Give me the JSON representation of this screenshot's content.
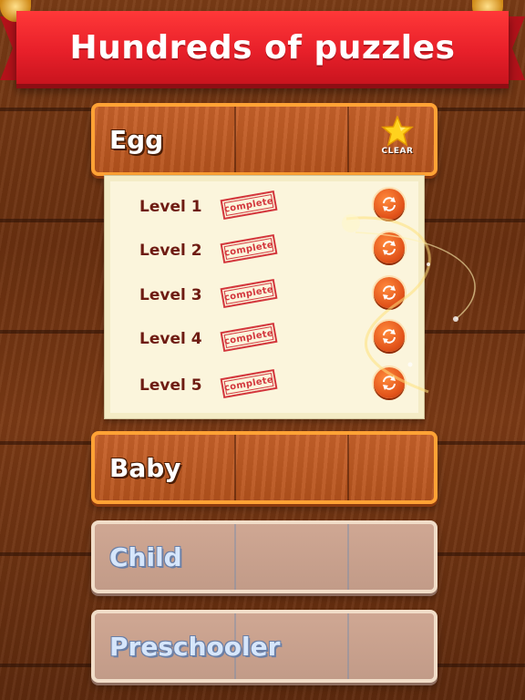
{
  "banner": {
    "title": "Hundreds of puzzles"
  },
  "categories": [
    {
      "label": "Egg",
      "state": "open",
      "badge": "CLEAR"
    },
    {
      "label": "Baby",
      "state": "unlocked"
    },
    {
      "label": "Child",
      "state": "locked"
    },
    {
      "label": "Preschooler",
      "state": "locked"
    }
  ],
  "levels": [
    {
      "label": "Level 1",
      "status": "complete"
    },
    {
      "label": "Level 2",
      "status": "complete"
    },
    {
      "label": "Level 3",
      "status": "complete"
    },
    {
      "label": "Level 4",
      "status": "complete"
    },
    {
      "label": "Level 5",
      "status": "complete"
    }
  ],
  "icons": {
    "clear_star": "star-icon",
    "replay": "replay-icon"
  },
  "colors": {
    "banner_red": "#e8202a",
    "category_border": "#ffa235",
    "stamp_red": "#d3363c",
    "level_text": "#6e1b12",
    "replay_orange": "#e2531a"
  }
}
